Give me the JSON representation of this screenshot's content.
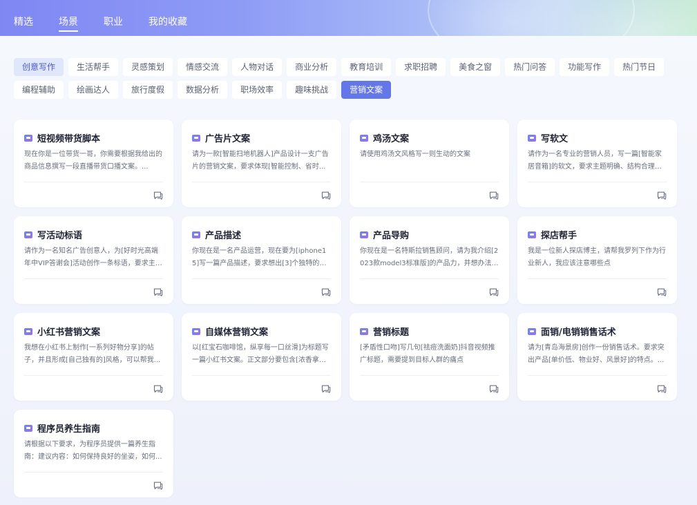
{
  "nav": {
    "items": [
      {
        "label": "精选"
      },
      {
        "label": "场景",
        "active": true
      },
      {
        "label": "职业"
      },
      {
        "label": "我的收藏"
      }
    ]
  },
  "tags": {
    "row1": [
      "创意写作",
      "生活帮手",
      "灵感策划",
      "情感交流",
      "人物对话",
      "商业分析",
      "教育培训",
      "求职招聘",
      "美食之窗",
      "热门问答",
      "功能写作",
      "热门节日"
    ],
    "row2": [
      "编程辅助",
      "绘画达人",
      "旅行度假",
      "数据分析",
      "职场效率",
      "趣味挑战",
      "营销文案"
    ],
    "active": "营销文案",
    "highlighted": "创意写作"
  },
  "cards": [
    {
      "title": "短视频带货脚本",
      "desc": "现在你是一位带货一哥，你需要根据我给出的商品信息撰写一段直播带货口播文案。..."
    },
    {
      "title": "广告片文案",
      "desc": "请为一款[智能扫地机器人]产品设计一支广告片的营销文案，要求体现[智能控制、省时..."
    },
    {
      "title": "鸡汤文案",
      "desc": "请使用鸡汤文风格写一则生动的文案"
    },
    {
      "title": "写软文",
      "desc": "请作为一名专业的营销人员，写一篇[智能家居音箱]的软文，要求主题明确、结构合理、语..."
    },
    {
      "title": "写活动标语",
      "desc": "请作为一名知名广告创意人，为[好时光高端年中VIP答谢会]活动创作一条标语，要求主题..."
    },
    {
      "title": "产品描述",
      "desc": "你现在是一名产品运营，现在要为[iphone15]写一篇产品描述，要求想出[3]个独特的卖点..."
    },
    {
      "title": "产品导购",
      "desc": "你现在是一名特斯拉销售顾问，请为我介绍[2023款model3标准版]的产品力，并想办法说..."
    },
    {
      "title": "探店帮手",
      "desc": "我是一位新人探店博主，请帮我罗列下作为行业新人，我应该注意哪些点"
    },
    {
      "title": "小红书营销文案",
      "desc": "我想在小红书上制作[一系列好物分享]的帖子，并且形成[自己独有的]风格，可以帮我..."
    },
    {
      "title": "自媒体营销文案",
      "desc": "以[红宝石咖啡馆，纵享每一口丝滑]为标题写一篇小红书文案。正文部分要包含[浓香拿铁..."
    },
    {
      "title": "营销标题",
      "desc": "[矛盾性口吻]写几句[祛痘洗面奶]抖音视频推广标题，需要提到目标人群的痛点"
    },
    {
      "title": "面销/电销销售话术",
      "desc": "请为[青岛海景房]创作一份销售话术。要求突出产品[单价低、物业好、风景好]的特点。..."
    },
    {
      "title": "程序员养生指南",
      "desc": "请根据以下要求，为程序员提供一篇养生指南：建议内容：如何保持良好的坐姿，如何..."
    }
  ],
  "icons": {
    "card_icon": "chat-bubble-icon",
    "card_action": "comment-icon"
  },
  "colors": {
    "accent": "#6477e8",
    "tag_highlight_bg": "#e1e7fb",
    "tag_highlight_text": "#4b5ad1"
  }
}
